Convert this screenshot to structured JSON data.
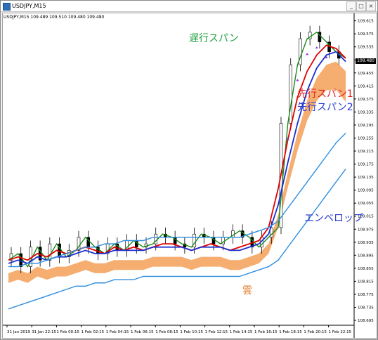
{
  "window": {
    "title": "USDJPY,M15",
    "controls": [
      "_",
      "□",
      "×"
    ]
  },
  "chart_header": {
    "symbol": "USDJPY,M15",
    "ohlc": "109.489 109.510 109.480 109.480"
  },
  "annotations": {
    "chikou": "遅行スパン",
    "senkou1": "先行スパン1",
    "senkou2": "先行スパン2",
    "envelope": "エンベロップ",
    "cloud": "雲"
  },
  "colors": {
    "chikou": "#1a8a1a",
    "senkou1": "#e00000",
    "senkou2": "#1a2fcf",
    "envelope": "#2f8fe0",
    "cloud": "#f4a460",
    "annot_senkou1": "#e02020",
    "annot_senkou2": "#2a3ad0",
    "annot_envelope": "#2a3ad0",
    "annot_cloud": "#e08030",
    "annot_chikou": "#20a040"
  },
  "current_price": "109.480",
  "chart_data": {
    "type": "line",
    "y_axis_labels": [
      "109.615",
      "109.575",
      "109.535",
      "109.495",
      "109.455",
      "109.415",
      "109.375",
      "109.335",
      "109.295",
      "109.255",
      "109.215",
      "109.175",
      "109.135",
      "109.095",
      "109.055",
      "109.015",
      "108.975",
      "108.935",
      "108.895",
      "108.855",
      "108.815",
      "108.775",
      "108.735",
      "108.695"
    ],
    "x_axis_labels": [
      "31 Jan 2019",
      "31 Jan 22:15",
      "1 Feb 00:15",
      "1 Feb 02:15",
      "1 Feb 04:15",
      "1 Feb 06:15",
      "1 Feb 08:15",
      "1 Feb 10:15",
      "1 Feb 12:15",
      "1 Feb 14:15",
      "1 Feb 16:15",
      "1 Feb 18:15",
      "1 Feb 20:15",
      "1 Feb 22:15"
    ],
    "ylim": [
      108.68,
      109.625
    ],
    "series": [
      {
        "name": "遅行スパン",
        "values": [
          108.88,
          108.9,
          108.86,
          108.92,
          108.88,
          108.93,
          108.89,
          108.91,
          108.95,
          108.92,
          108.9,
          108.93,
          108.91,
          108.94,
          108.92,
          108.93,
          108.96,
          108.95,
          108.93,
          108.92,
          108.96,
          108.95,
          108.93,
          108.95,
          108.97,
          108.95,
          108.92,
          108.95,
          108.98,
          109.3,
          109.48,
          109.56,
          109.58,
          109.55,
          109.52,
          109.5
        ]
      },
      {
        "name": "先行スパン1",
        "values": [
          108.88,
          108.89,
          108.88,
          108.9,
          108.89,
          108.91,
          108.9,
          108.91,
          108.92,
          108.91,
          108.9,
          108.92,
          108.91,
          108.92,
          108.91,
          108.92,
          108.93,
          108.93,
          108.92,
          108.91,
          108.92,
          108.93,
          108.92,
          108.91,
          108.92,
          108.93,
          108.94,
          108.98,
          109.1,
          109.25,
          109.38,
          109.46,
          109.51,
          109.54,
          109.53,
          109.5
        ]
      },
      {
        "name": "先行スパン2",
        "values": [
          108.87,
          108.88,
          108.87,
          108.89,
          108.88,
          108.89,
          108.89,
          108.9,
          108.91,
          108.9,
          108.9,
          108.91,
          108.91,
          108.91,
          108.91,
          108.92,
          108.92,
          108.92,
          108.92,
          108.91,
          108.92,
          108.92,
          108.92,
          108.91,
          108.91,
          108.92,
          108.93,
          108.96,
          109.05,
          109.18,
          109.3,
          109.4,
          109.47,
          109.51,
          109.52,
          109.49
        ]
      },
      {
        "name": "エンベロップ_upper",
        "values": [
          108.86,
          108.86,
          108.87,
          108.87,
          108.88,
          108.89,
          108.9,
          108.91,
          108.92,
          108.92,
          108.93,
          108.93,
          108.94,
          108.94,
          108.94,
          108.95,
          108.95,
          108.95,
          108.95,
          108.95,
          108.95,
          108.95,
          108.95,
          108.95,
          108.95,
          108.96,
          108.97,
          108.98,
          109.0,
          109.04,
          109.08,
          109.12,
          109.16,
          109.2,
          109.24,
          109.27
        ]
      },
      {
        "name": "エンベロップ_lower",
        "values": [
          108.73,
          108.74,
          108.75,
          108.76,
          108.77,
          108.78,
          108.79,
          108.8,
          108.8,
          108.81,
          108.81,
          108.82,
          108.82,
          108.82,
          108.83,
          108.83,
          108.83,
          108.83,
          108.83,
          108.83,
          108.83,
          108.83,
          108.83,
          108.83,
          108.83,
          108.84,
          108.85,
          108.86,
          108.88,
          108.92,
          108.96,
          109.0,
          109.04,
          109.08,
          109.12,
          109.16
        ]
      }
    ]
  }
}
